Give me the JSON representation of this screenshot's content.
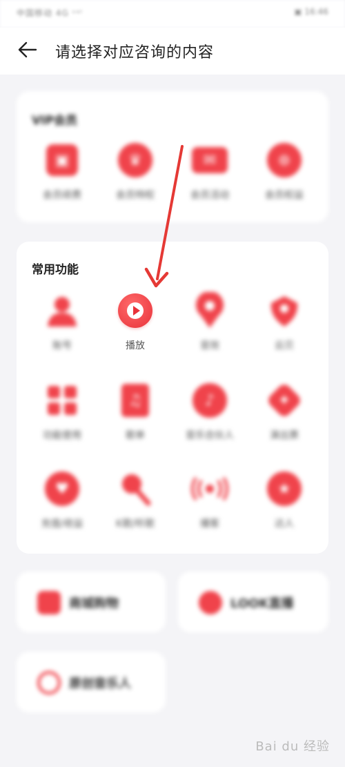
{
  "status_bar": {
    "left": "中国移动 4G ᵛᵒˡ",
    "right": "▣ 16:46"
  },
  "header": {
    "title": "请选择对应咨询的内容"
  },
  "vip": {
    "title": "VIP会员",
    "items": [
      {
        "label": "会员续费",
        "icon": "vip-card-icon"
      },
      {
        "label": "会员特权",
        "icon": "vip-crown-icon"
      },
      {
        "label": "会员活动",
        "icon": "vip-ticket-icon"
      },
      {
        "label": "会员权益",
        "icon": "vip-badge-icon"
      }
    ]
  },
  "common": {
    "title": "常用功能",
    "items": [
      {
        "label": "账号",
        "icon": "account-icon"
      },
      {
        "label": "播放",
        "icon": "play-icon"
      },
      {
        "label": "音效",
        "icon": "sound-effect-icon"
      },
      {
        "label": "云贝",
        "icon": "cloud-shell-icon"
      },
      {
        "label": "功能使用",
        "icon": "feature-grid-icon"
      },
      {
        "label": "歌单",
        "icon": "playlist-icon"
      },
      {
        "label": "音乐合伙人",
        "icon": "music-partner-icon"
      },
      {
        "label": "演出票",
        "icon": "ticket-icon"
      },
      {
        "label": "充值/收益",
        "icon": "recharge-icon"
      },
      {
        "label": "K歌/听歌",
        "icon": "karaoke-icon"
      },
      {
        "label": "播客",
        "icon": "podcast-icon"
      },
      {
        "label": "达人",
        "icon": "star-icon"
      }
    ]
  },
  "bottom_cards": [
    {
      "label": "商城购物",
      "icon": "shop-bag-icon"
    },
    {
      "label": "LOOK直播",
      "icon": "live-icon"
    },
    {
      "label": "原创音乐人",
      "icon": "musician-icon"
    }
  ],
  "watermark": "Bai du 经验",
  "colors": {
    "accent": "#f0434b",
    "background": "#f4f4f7",
    "card": "#ffffff"
  }
}
